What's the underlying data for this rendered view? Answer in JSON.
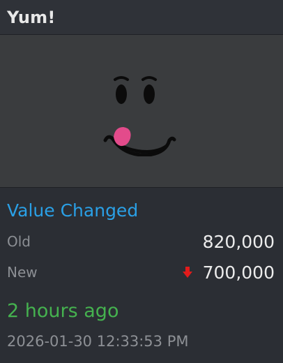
{
  "item": {
    "title": "Yum!",
    "thumbnail_icon": "smiling-face-tongue-icon"
  },
  "change": {
    "heading": "Value Changed",
    "old_label": "Old",
    "old_value": "820,000",
    "new_label": "New",
    "new_value": "700,000",
    "direction_icon": "down-arrow-icon",
    "direction_color": "#e21b1b"
  },
  "meta": {
    "relative_time": "2 hours ago",
    "timestamp": "2026-01-30 12:33:53 PM"
  },
  "colors": {
    "heading": "#2aa0e6",
    "relative_time": "#45b24f",
    "background": "#2b2e34"
  }
}
